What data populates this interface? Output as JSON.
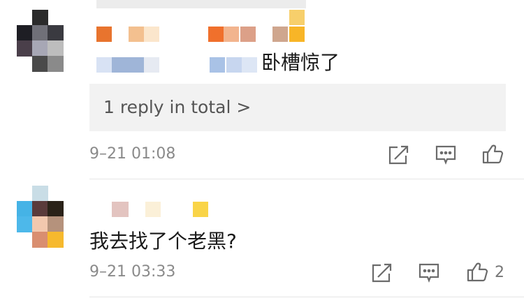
{
  "comments": [
    {
      "text": "卧槽惊了",
      "reply_summary": "1 reply in total >",
      "timestamp": "9–21 01:08",
      "like_count": ""
    },
    {
      "text": "我去找了个老黑?",
      "timestamp": "9–21 03:33",
      "like_count": "2"
    }
  ],
  "icons": {
    "share": "share-icon",
    "comment": "comment-icon",
    "like": "thumbs-up-icon"
  },
  "colors": {
    "background": "#ffffff",
    "reply_box": "#f2f2f2",
    "timestamp": "#8a8a8a",
    "icon_stroke": "#6b6b6b"
  }
}
